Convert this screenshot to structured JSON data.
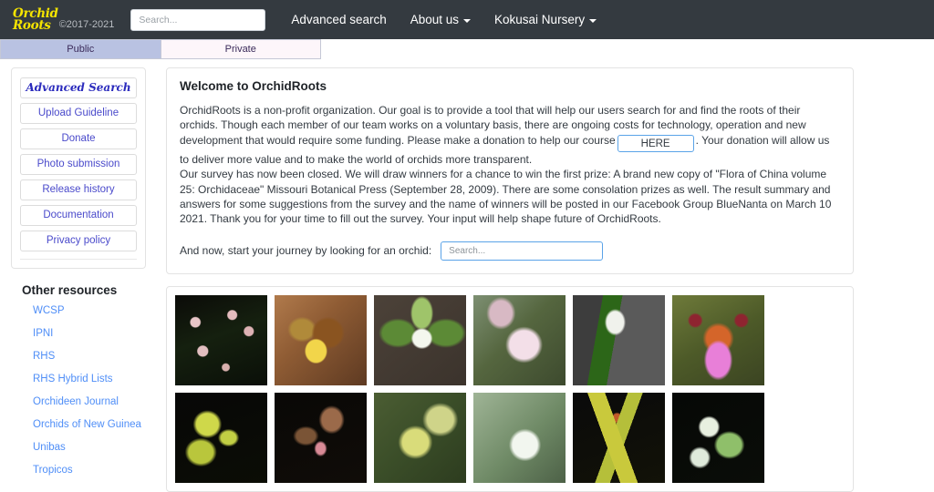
{
  "navbar": {
    "brand_line1": "Orchid",
    "brand_line2": "Roots",
    "copyright": "©2017-2021",
    "search_placeholder": "Search...",
    "search_value": "",
    "links": [
      {
        "label": "Advanced search",
        "has_caret": false
      },
      {
        "label": "About us",
        "has_caret": true
      },
      {
        "label": "Kokusai Nursery",
        "has_caret": true
      }
    ]
  },
  "tabs": [
    {
      "label": "Public",
      "active": true
    },
    {
      "label": "Private",
      "active": false
    }
  ],
  "sidebar": {
    "buttons": [
      {
        "label": "Advanced Search",
        "style": "fancy"
      },
      {
        "label": "Upload Guideline",
        "style": "plain"
      },
      {
        "label": "Donate",
        "style": "plain"
      },
      {
        "label": "Photo submission",
        "style": "plain"
      },
      {
        "label": "Release history",
        "style": "plain"
      },
      {
        "label": "Documentation",
        "style": "plain"
      },
      {
        "label": "Privacy policy",
        "style": "plain"
      }
    ],
    "resources_title": "Other resources",
    "resources": [
      {
        "label": "WCSP"
      },
      {
        "label": "IPNI"
      },
      {
        "label": "RHS"
      },
      {
        "label": "RHS Hybrid Lists"
      },
      {
        "label": "Orchideen Journal"
      },
      {
        "label": "Orchids of New Guinea"
      },
      {
        "label": "Unibas"
      },
      {
        "label": "Tropicos"
      }
    ]
  },
  "welcome": {
    "title": "Welcome to OrchidRoots",
    "paragraph1_before": "OrchidRoots is a non-profit organization. Our goal is to provide a tool that will help our users search for and find the roots of their orchids. Though each member of our team works on a voluntary basis, there are ongoing costs for technology, operation and new development that would require some funding. Please make a donation to help our course",
    "here_label": "HERE",
    "paragraph1_after": ". Your donation will allow us to deliver more value and to make the world of orchids more transparent.",
    "paragraph2": "Our survey has now been closed. We will draw winners for a chance to win the first prize: A brand new copy of \"Flora of China volume 25: Orchidaceae\" Missouri Botanical Press (September 28, 2009). There are some consolation prizes as well. The result summary and answers for some suggestions from the survey and the name of winners will be posted in our Facebook Group BlueNanta on March 10 2021. Thank you for your time to fill out the survey. Your input will help shape future of OrchidRoots.",
    "journey_label": "And now, start your journey by looking for an orchid:",
    "journey_search_placeholder": "Search...",
    "journey_search_value": ""
  },
  "gallery": {
    "rows": [
      [
        {
          "name": "thumb-pink-cluster-dark"
        },
        {
          "name": "thumb-brown-yellow-oncidium"
        },
        {
          "name": "thumb-green-white-habenaria"
        },
        {
          "name": "thumb-pink-striped-star"
        },
        {
          "name": "thumb-white-bud-green-stem"
        },
        {
          "name": "thumb-orange-magenta-spider"
        }
      ],
      [
        {
          "name": "thumb-yellow-green-cluster"
        },
        {
          "name": "thumb-brown-pink-pendant"
        },
        {
          "name": "thumb-yellow-spike-grass"
        },
        {
          "name": "thumb-white-green-bloom"
        },
        {
          "name": "thumb-yellow-leaf-dark"
        },
        {
          "name": "thumb-green-white-twin"
        }
      ]
    ]
  },
  "colors": {
    "navbar_bg": "#343a40",
    "brand_yellow": "#f5e400",
    "tab_active_bg": "#b9c2e2",
    "tab_inactive_bg": "#fdf6fa",
    "link_blue": "#4f8ef7",
    "button_text": "#4a4acb",
    "accent_border": "#5aa3e8"
  }
}
